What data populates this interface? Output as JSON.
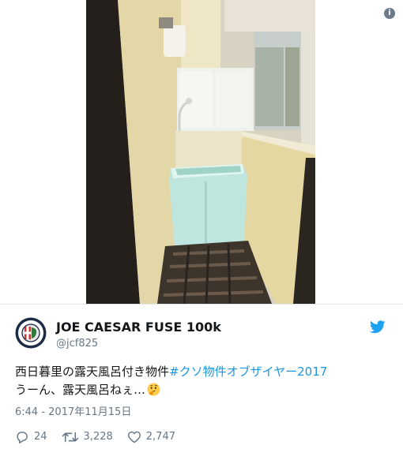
{
  "media": {
    "info_icon_name": "info-icon",
    "photo_description_icon": "photo-balcony-bath"
  },
  "tweet": {
    "display_name": "JOE CAESAR FUSE 100k",
    "handle": "@jcf825",
    "text_plain": "西日暮里の露天風呂付き物件",
    "hashtag": "#クソ物件オブザイヤー2017",
    "line2": "うーん、露天風呂ねぇ…",
    "timestamp": "6:44 - 2017年11月15日",
    "replies": "24",
    "retweets": "3,228",
    "likes": "2,747"
  },
  "colors": {
    "text": "#14171a",
    "secondary": "#657786",
    "link": "#1b95e0",
    "twitter_blue": "#1da1f2"
  }
}
